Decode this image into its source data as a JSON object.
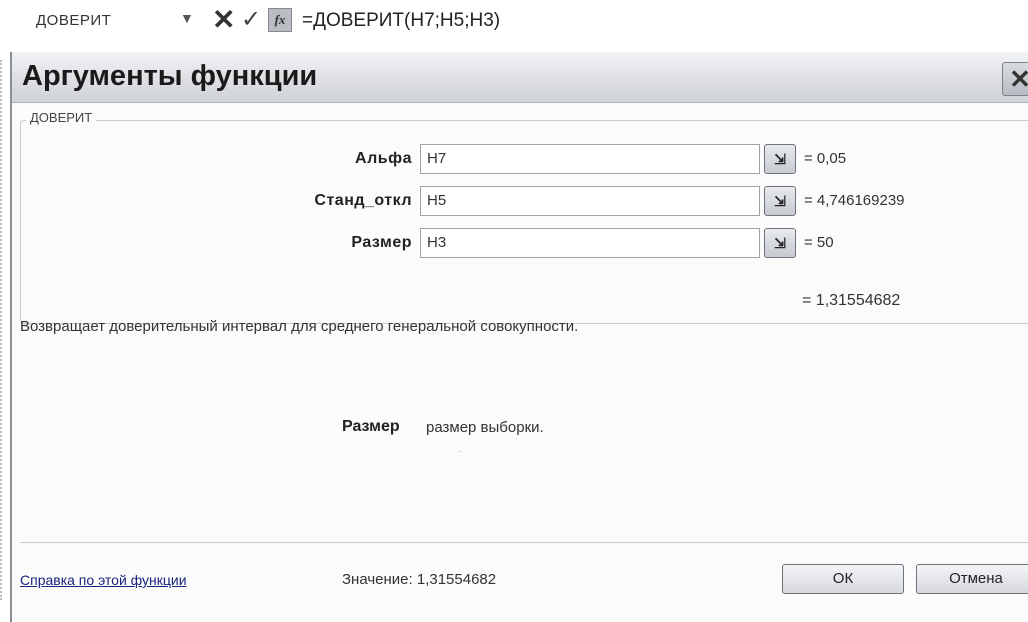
{
  "formula_bar": {
    "name_box": "ДОВЕРИТ",
    "dropdown_icon": "▼",
    "cancel_icon": "✕",
    "enter_icon": "✓",
    "fx_label": "fx",
    "formula": "=ДОВЕРИТ(H7;H5;H3)"
  },
  "dialog": {
    "title": "Аргументы функции",
    "close_icon": "✕",
    "group_label": "ДОВЕРИТ",
    "arguments": [
      {
        "label": "Альфа",
        "value": "H7",
        "result": "= 0,05"
      },
      {
        "label": "Станд_откл",
        "value": "H5",
        "result": "= 4,746169239"
      },
      {
        "label": "Размер",
        "value": "H3",
        "result": "= 50"
      }
    ],
    "ref_icon": "⇲",
    "function_result": "= 1,31554682",
    "description": "Возвращает доверительный интервал для среднего генеральной совокупности.",
    "param_name": "Размер",
    "param_description": "размер выборки.",
    "stray_mark": "·",
    "help_link": "Справка по этой функции",
    "value_line": "Значение: 1,31554682",
    "ok_button": "ОК",
    "cancel_button": "Отмена"
  }
}
